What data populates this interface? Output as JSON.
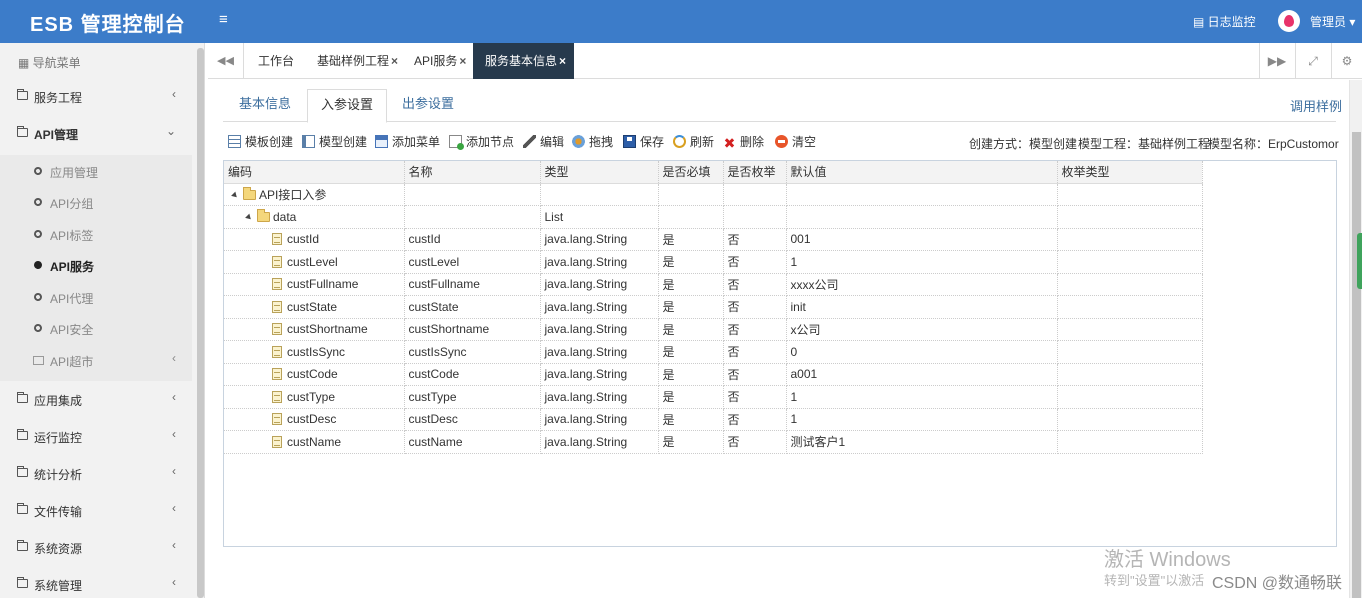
{
  "header": {
    "brand": "ESB 管理控制台",
    "menu_toggle": "≡",
    "log_monitor": "日志监控",
    "user": "管理员"
  },
  "sidebar": {
    "nav_title": "导航菜单",
    "items": [
      {
        "label": "服务工程",
        "arrow": "‹"
      },
      {
        "label": "API管理",
        "arrow": "⌄"
      },
      {
        "label": "应用集成",
        "arrow": "‹"
      },
      {
        "label": "运行监控",
        "arrow": "‹"
      },
      {
        "label": "统计分析",
        "arrow": "‹"
      },
      {
        "label": "文件传输",
        "arrow": "‹"
      },
      {
        "label": "系统资源",
        "arrow": "‹"
      },
      {
        "label": "系统管理",
        "arrow": "‹"
      }
    ],
    "api_sub": [
      {
        "label": "应用管理"
      },
      {
        "label": "API分组"
      },
      {
        "label": "API标签"
      },
      {
        "label": "API服务"
      },
      {
        "label": "API代理"
      },
      {
        "label": "API安全"
      },
      {
        "label": "API超市",
        "arrow": "‹"
      }
    ]
  },
  "tabs": {
    "items": [
      {
        "label": "工作台",
        "close": ""
      },
      {
        "label": "基础样例工程",
        "close": "×"
      },
      {
        "label": "API服务",
        "close": "×"
      },
      {
        "label": "服务基本信息",
        "close": "×"
      }
    ]
  },
  "subtabs": {
    "basic": "基本信息",
    "input": "入参设置",
    "output": "出参设置",
    "sample": "调用样例"
  },
  "toolbar": {
    "template_create": "模板创建",
    "model_create": "模型创建",
    "add_menu": "添加菜单",
    "add_node": "添加节点",
    "edit": "编辑",
    "drag": "拖拽",
    "save": "保存",
    "refresh": "刷新",
    "delete": "删除",
    "clear": "清空"
  },
  "meta": {
    "create_mode": "创建方式：模型创建",
    "model_project": "模型工程：基础样例工程",
    "model_name": "模型名称：ErpCustomor"
  },
  "grid": {
    "columns": [
      "编码",
      "名称",
      "类型",
      "是否必填",
      "是否枚举",
      "默认值",
      "枚举类型"
    ],
    "root": {
      "code": "API接口入参"
    },
    "data_node": {
      "code": "data",
      "type": "List"
    },
    "rows": [
      {
        "code": "custId",
        "name": "custId",
        "type": "java.lang.String",
        "required": "是",
        "enum": "否",
        "default": "001"
      },
      {
        "code": "custLevel",
        "name": "custLevel",
        "type": "java.lang.String",
        "required": "是",
        "enum": "否",
        "default": "1"
      },
      {
        "code": "custFullname",
        "name": "custFullname",
        "type": "java.lang.String",
        "required": "是",
        "enum": "否",
        "default": "xxxx公司"
      },
      {
        "code": "custState",
        "name": "custState",
        "type": "java.lang.String",
        "required": "是",
        "enum": "否",
        "default": "init"
      },
      {
        "code": "custShortname",
        "name": "custShortname",
        "type": "java.lang.String",
        "required": "是",
        "enum": "否",
        "default": "x公司"
      },
      {
        "code": "custIsSync",
        "name": "custIsSync",
        "type": "java.lang.String",
        "required": "是",
        "enum": "否",
        "default": "0"
      },
      {
        "code": "custCode",
        "name": "custCode",
        "type": "java.lang.String",
        "required": "是",
        "enum": "否",
        "default": "a001"
      },
      {
        "code": "custType",
        "name": "custType",
        "type": "java.lang.String",
        "required": "是",
        "enum": "否",
        "default": "1"
      },
      {
        "code": "custDesc",
        "name": "custDesc",
        "type": "java.lang.String",
        "required": "是",
        "enum": "否",
        "default": "1"
      },
      {
        "code": "custName",
        "name": "custName",
        "type": "java.lang.String",
        "required": "是",
        "enum": "否",
        "default": "测试客户1"
      }
    ]
  },
  "watermark": {
    "activate_title": "激活 Windows",
    "activate_sub": "转到\"设置\"以激活",
    "csdn": "CSDN @数通畅联"
  },
  "colors": {
    "header_bg": "#3c7cc9",
    "active_tab_bg": "#273a4d",
    "link": "#3c6e9e"
  }
}
